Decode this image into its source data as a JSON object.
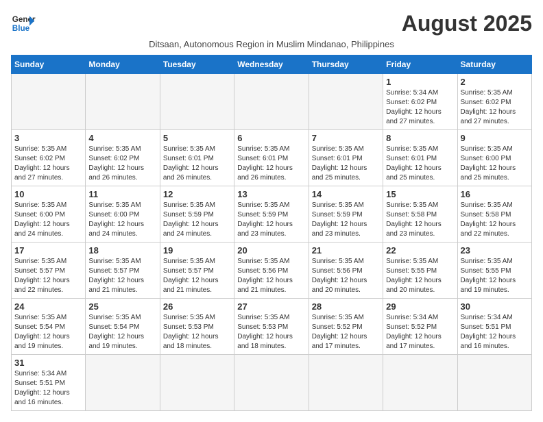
{
  "logo": {
    "line1": "General",
    "line2": "Blue"
  },
  "title": "August 2025",
  "subtitle": "Ditsaan, Autonomous Region in Muslim Mindanao, Philippines",
  "weekdays": [
    "Sunday",
    "Monday",
    "Tuesday",
    "Wednesday",
    "Thursday",
    "Friday",
    "Saturday"
  ],
  "weeks": [
    [
      {
        "day": "",
        "info": ""
      },
      {
        "day": "",
        "info": ""
      },
      {
        "day": "",
        "info": ""
      },
      {
        "day": "",
        "info": ""
      },
      {
        "day": "",
        "info": ""
      },
      {
        "day": "1",
        "info": "Sunrise: 5:34 AM\nSunset: 6:02 PM\nDaylight: 12 hours and 27 minutes."
      },
      {
        "day": "2",
        "info": "Sunrise: 5:35 AM\nSunset: 6:02 PM\nDaylight: 12 hours and 27 minutes."
      }
    ],
    [
      {
        "day": "3",
        "info": "Sunrise: 5:35 AM\nSunset: 6:02 PM\nDaylight: 12 hours and 27 minutes."
      },
      {
        "day": "4",
        "info": "Sunrise: 5:35 AM\nSunset: 6:02 PM\nDaylight: 12 hours and 26 minutes."
      },
      {
        "day": "5",
        "info": "Sunrise: 5:35 AM\nSunset: 6:01 PM\nDaylight: 12 hours and 26 minutes."
      },
      {
        "day": "6",
        "info": "Sunrise: 5:35 AM\nSunset: 6:01 PM\nDaylight: 12 hours and 26 minutes."
      },
      {
        "day": "7",
        "info": "Sunrise: 5:35 AM\nSunset: 6:01 PM\nDaylight: 12 hours and 25 minutes."
      },
      {
        "day": "8",
        "info": "Sunrise: 5:35 AM\nSunset: 6:01 PM\nDaylight: 12 hours and 25 minutes."
      },
      {
        "day": "9",
        "info": "Sunrise: 5:35 AM\nSunset: 6:00 PM\nDaylight: 12 hours and 25 minutes."
      }
    ],
    [
      {
        "day": "10",
        "info": "Sunrise: 5:35 AM\nSunset: 6:00 PM\nDaylight: 12 hours and 24 minutes."
      },
      {
        "day": "11",
        "info": "Sunrise: 5:35 AM\nSunset: 6:00 PM\nDaylight: 12 hours and 24 minutes."
      },
      {
        "day": "12",
        "info": "Sunrise: 5:35 AM\nSunset: 5:59 PM\nDaylight: 12 hours and 24 minutes."
      },
      {
        "day": "13",
        "info": "Sunrise: 5:35 AM\nSunset: 5:59 PM\nDaylight: 12 hours and 23 minutes."
      },
      {
        "day": "14",
        "info": "Sunrise: 5:35 AM\nSunset: 5:59 PM\nDaylight: 12 hours and 23 minutes."
      },
      {
        "day": "15",
        "info": "Sunrise: 5:35 AM\nSunset: 5:58 PM\nDaylight: 12 hours and 23 minutes."
      },
      {
        "day": "16",
        "info": "Sunrise: 5:35 AM\nSunset: 5:58 PM\nDaylight: 12 hours and 22 minutes."
      }
    ],
    [
      {
        "day": "17",
        "info": "Sunrise: 5:35 AM\nSunset: 5:57 PM\nDaylight: 12 hours and 22 minutes."
      },
      {
        "day": "18",
        "info": "Sunrise: 5:35 AM\nSunset: 5:57 PM\nDaylight: 12 hours and 21 minutes."
      },
      {
        "day": "19",
        "info": "Sunrise: 5:35 AM\nSunset: 5:57 PM\nDaylight: 12 hours and 21 minutes."
      },
      {
        "day": "20",
        "info": "Sunrise: 5:35 AM\nSunset: 5:56 PM\nDaylight: 12 hours and 21 minutes."
      },
      {
        "day": "21",
        "info": "Sunrise: 5:35 AM\nSunset: 5:56 PM\nDaylight: 12 hours and 20 minutes."
      },
      {
        "day": "22",
        "info": "Sunrise: 5:35 AM\nSunset: 5:55 PM\nDaylight: 12 hours and 20 minutes."
      },
      {
        "day": "23",
        "info": "Sunrise: 5:35 AM\nSunset: 5:55 PM\nDaylight: 12 hours and 19 minutes."
      }
    ],
    [
      {
        "day": "24",
        "info": "Sunrise: 5:35 AM\nSunset: 5:54 PM\nDaylight: 12 hours and 19 minutes."
      },
      {
        "day": "25",
        "info": "Sunrise: 5:35 AM\nSunset: 5:54 PM\nDaylight: 12 hours and 19 minutes."
      },
      {
        "day": "26",
        "info": "Sunrise: 5:35 AM\nSunset: 5:53 PM\nDaylight: 12 hours and 18 minutes."
      },
      {
        "day": "27",
        "info": "Sunrise: 5:35 AM\nSunset: 5:53 PM\nDaylight: 12 hours and 18 minutes."
      },
      {
        "day": "28",
        "info": "Sunrise: 5:35 AM\nSunset: 5:52 PM\nDaylight: 12 hours and 17 minutes."
      },
      {
        "day": "29",
        "info": "Sunrise: 5:34 AM\nSunset: 5:52 PM\nDaylight: 12 hours and 17 minutes."
      },
      {
        "day": "30",
        "info": "Sunrise: 5:34 AM\nSunset: 5:51 PM\nDaylight: 12 hours and 16 minutes."
      }
    ],
    [
      {
        "day": "31",
        "info": "Sunrise: 5:34 AM\nSunset: 5:51 PM\nDaylight: 12 hours and 16 minutes."
      },
      {
        "day": "",
        "info": ""
      },
      {
        "day": "",
        "info": ""
      },
      {
        "day": "",
        "info": ""
      },
      {
        "day": "",
        "info": ""
      },
      {
        "day": "",
        "info": ""
      },
      {
        "day": "",
        "info": ""
      }
    ]
  ]
}
